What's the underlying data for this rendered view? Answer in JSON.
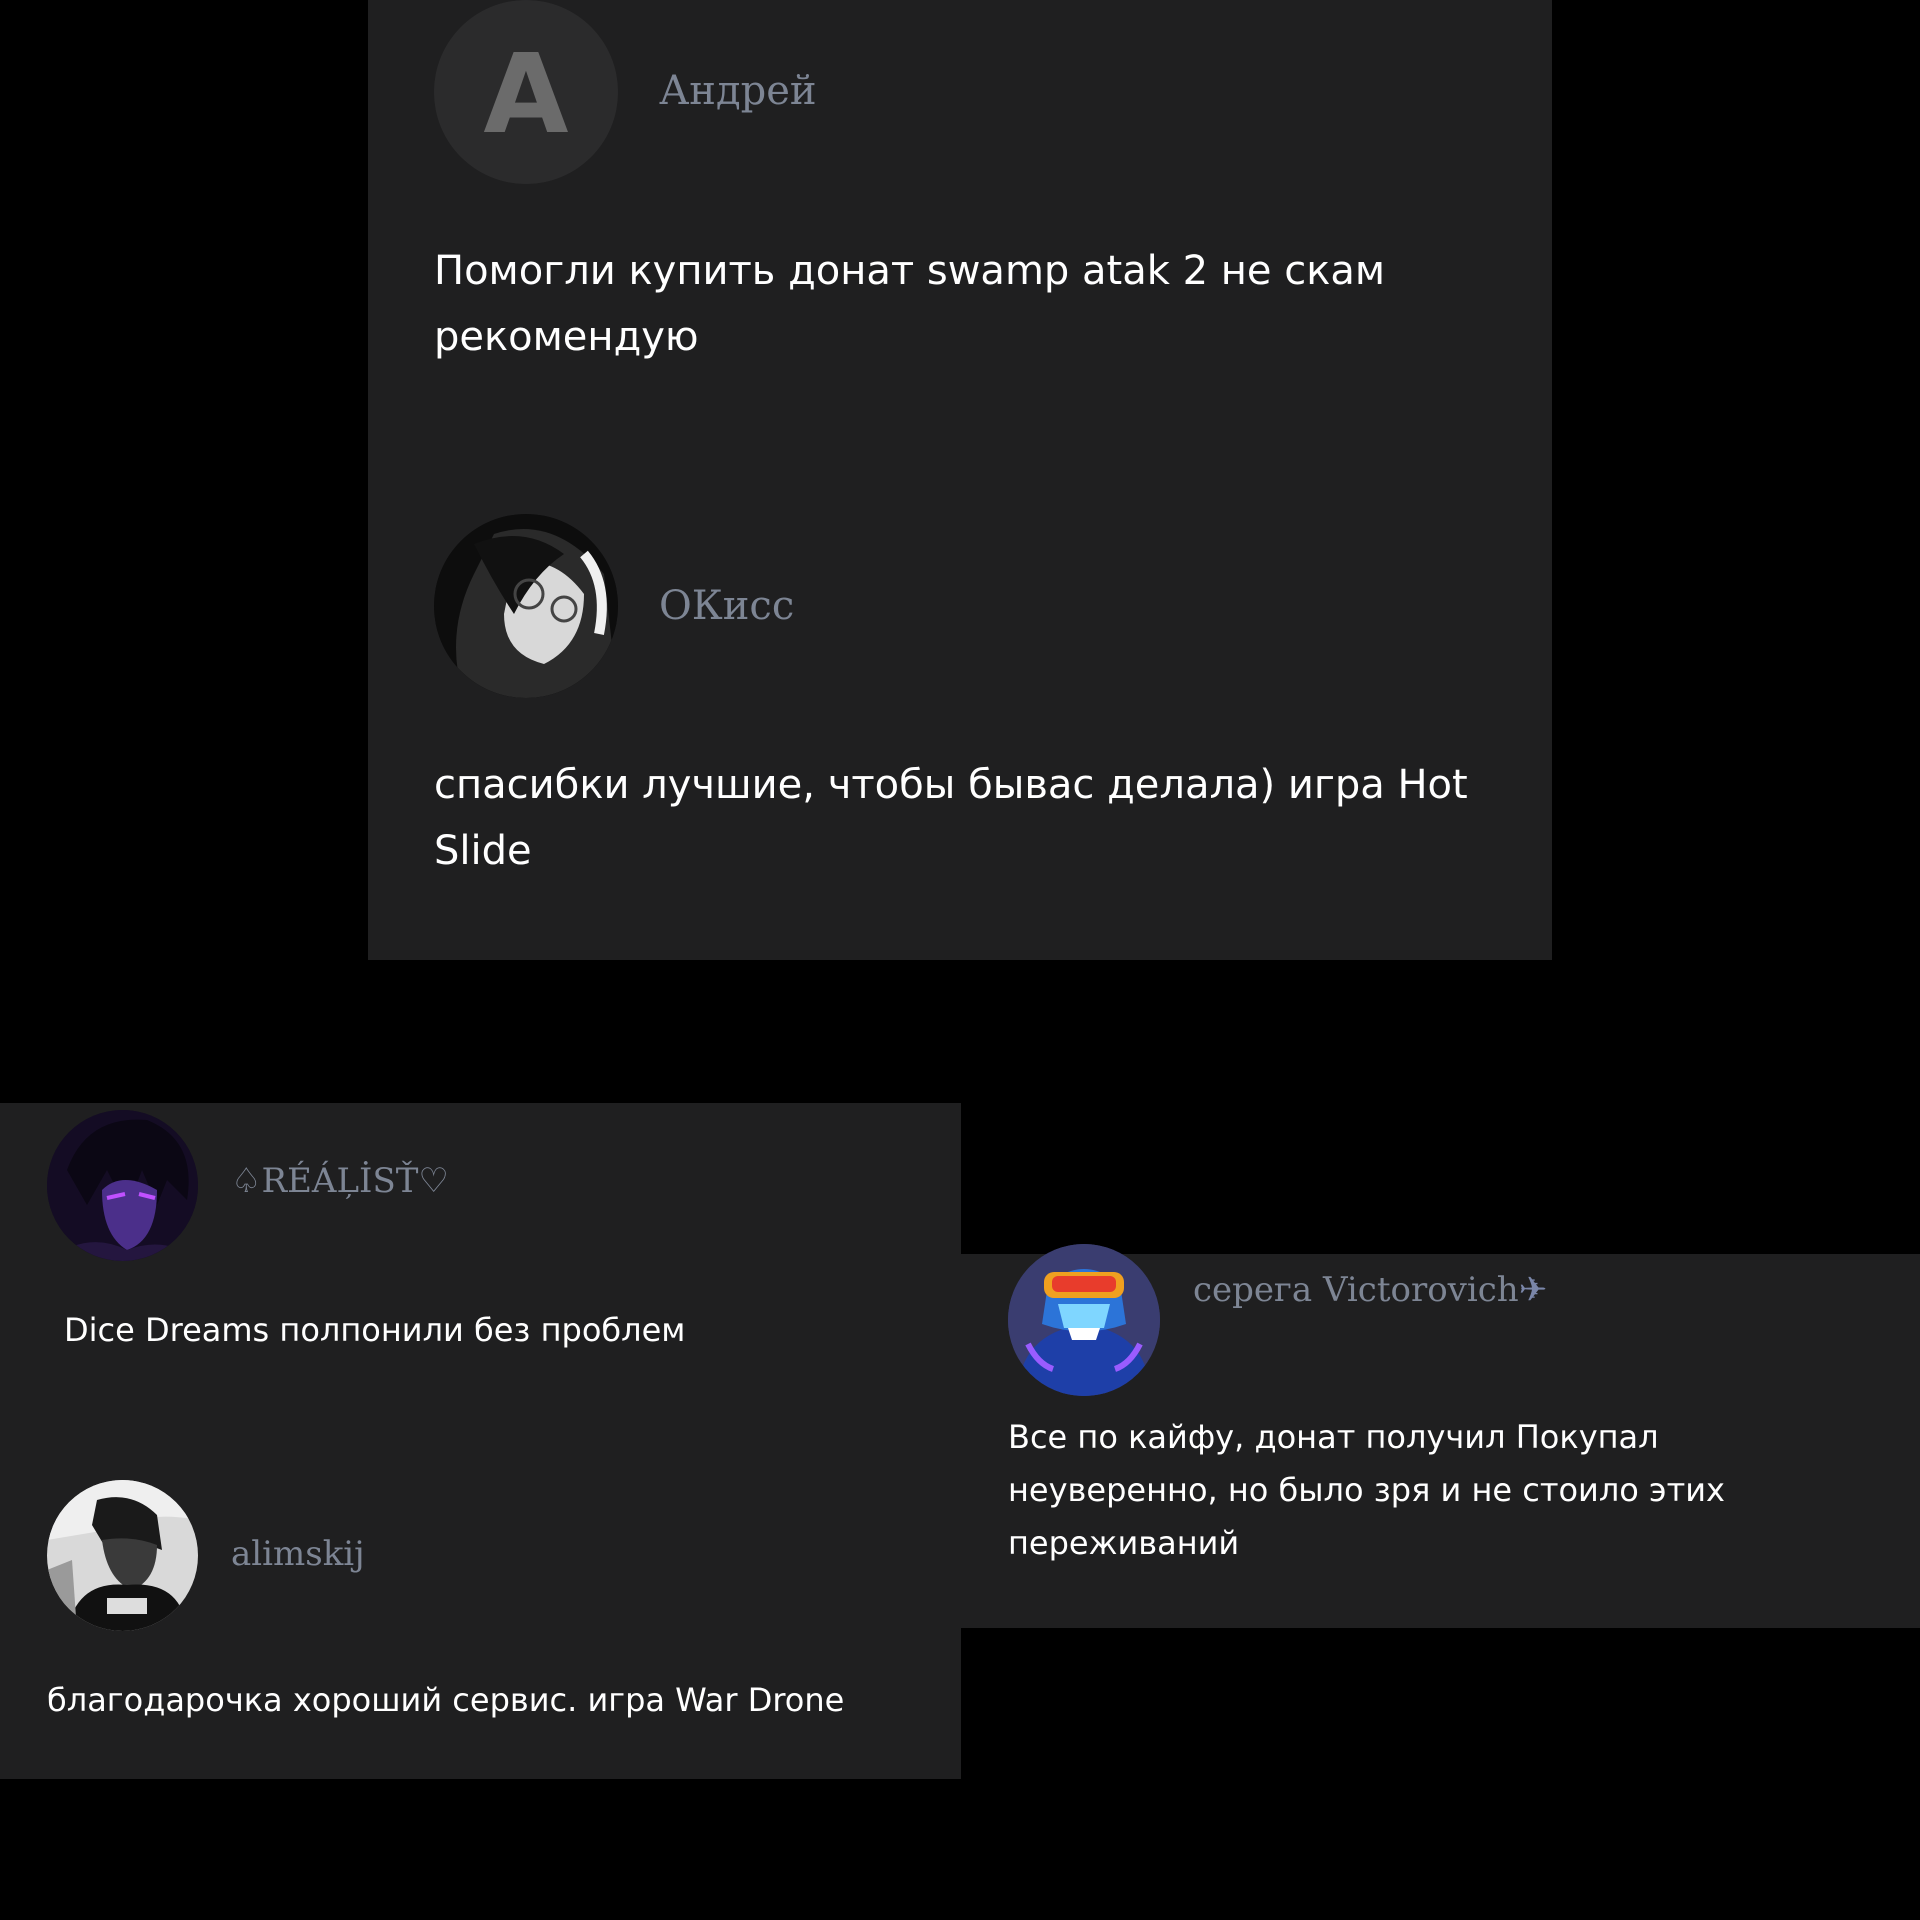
{
  "reviews_top": [
    {
      "username": "Андрей",
      "avatar_letter": "A",
      "text": "Помогли купить донат swamp atak 2 не скам рекомендую"
    },
    {
      "username": "ОКисс",
      "text": "спасибки лучшие, чтобы бывас делала) игра Hot Slide"
    }
  ],
  "reviews_left": [
    {
      "username": "♤RÉÁĻİSŤ♡",
      "text": "Dice Dreams полпонили без проблем"
    },
    {
      "username": "alimskij",
      "text": "благодарочка хороший сервис. игра War Drone"
    }
  ],
  "reviews_right": [
    {
      "username": "серега Victorovich",
      "username_emoji": "✈",
      "text": "Все по кайфу, донат получил Покупал неуверенно, но было зря и не стоило этих переживаний"
    }
  ],
  "colors": {
    "page_background": "#000000",
    "panel_background": "#1f1f20",
    "username_color": "#7d8594",
    "text_color": "#ffffff"
  }
}
